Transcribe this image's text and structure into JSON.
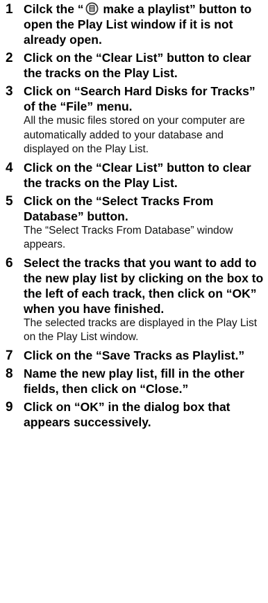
{
  "steps": [
    {
      "num": "1",
      "title_prefix": "Cilck the “",
      "title_suffix": " make a playlist” button to open the Play List window if it is not already open.",
      "icon": "playlist-icon"
    },
    {
      "num": "2",
      "title": "Click on the “Clear List” button to clear the tracks on the Play List."
    },
    {
      "num": "3",
      "title": "Click on “Search Hard Disks for Tracks” of the “File” menu.",
      "detail": "All the music files stored on your computer are automatically added to your database and displayed on the Play List."
    },
    {
      "num": "4",
      "title": "Click on the “Clear List” button to clear the tracks on the Play List."
    },
    {
      "num": "5",
      "title": "Click on the “Select Tracks From Database” button.",
      "detail": "The “Select Tracks From Database” window appears."
    },
    {
      "num": "6",
      "title": "Select the tracks that you want to add to the new play list by clicking on the box to the left of each track, then click on “OK” when you have finished.",
      "detail": "The selected tracks are displayed in the Play List on the Play List window."
    },
    {
      "num": "7",
      "title": "Click on the “Save Tracks as Playlist.”"
    },
    {
      "num": "8",
      "title": "Name the new play list, fill in the other fields, then click on “Close.”"
    },
    {
      "num": "9",
      "title": "Click on “OK” in the dialog box that appears successively."
    }
  ]
}
